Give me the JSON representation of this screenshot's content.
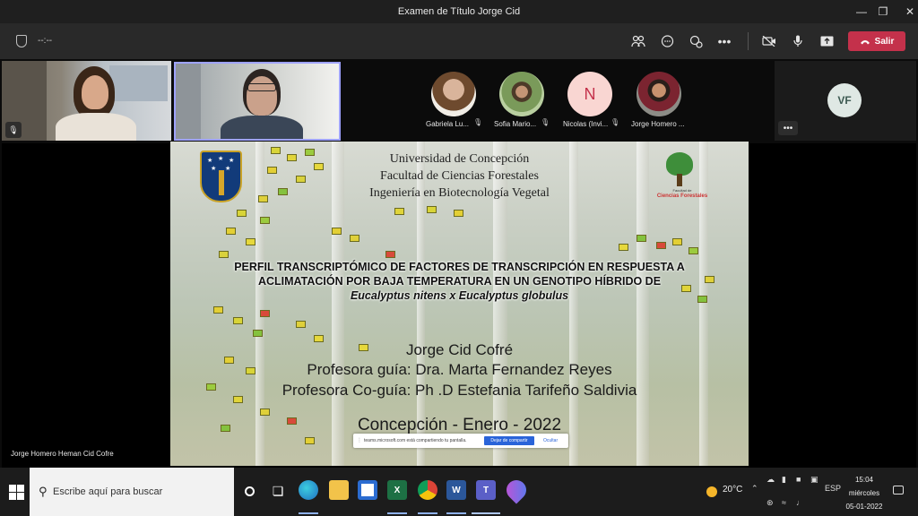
{
  "window": {
    "title": "Examen de Título Jorge Cid"
  },
  "toolbar": {
    "timer": "--:--",
    "leave_label": "Salir"
  },
  "participants": [
    {
      "name": "Gabriela Lu..."
    },
    {
      "name": "Sofia Mario..."
    },
    {
      "name": "Nicolas (Invi...",
      "initial": "N"
    },
    {
      "name": "Jorge Homero ..."
    }
  ],
  "vf_initials": "VF",
  "slide": {
    "uni_line1": "Universidad de Concepción",
    "uni_line2": "Facultad de Ciencias Forestales",
    "uni_line3": "Ingeniería en Biotecnología Vegetal",
    "fac_logo_small": "Facultad de",
    "fac_logo_name": "Ciencias Forestales",
    "title_line1": "PERFIL TRANSCRIPTÓMICO DE FACTORES DE TRANSCRIPCIÓN EN RESPUESTA A",
    "title_line2": "ACLIMATACIÓN POR BAJA TEMPERATURA EN UN GENOTIPO HÍBRIDO DE",
    "title_line3": "Eucalyptus nitens x Eucalyptus globulus",
    "author": "Jorge Cid Cofré",
    "guide": "Profesora guía: Dra. Marta Fernandez Reyes",
    "coguide": "Profesora Co-guía: Ph .D Estefania Tarifeño Saldivia",
    "location_date": "Concepción - Enero - 2022"
  },
  "sharebar": {
    "text": "teams.microsoft.com está compartiendo tu pantalla.",
    "stop_label": "Dejar de compartir",
    "hide_label": "Ocultar"
  },
  "speaker_name": "Jorge Homero Heman Cid Cofre",
  "taskbar": {
    "search_placeholder": "Escribe aquí para buscar",
    "temperature": "20°C",
    "language": "ESP",
    "time": "15:04",
    "day": "miércoles",
    "date": "05-01-2022"
  },
  "colors": {
    "leave": "#c4314b",
    "accent": "#9ea2ff",
    "stop_share": "#2a64d9"
  }
}
